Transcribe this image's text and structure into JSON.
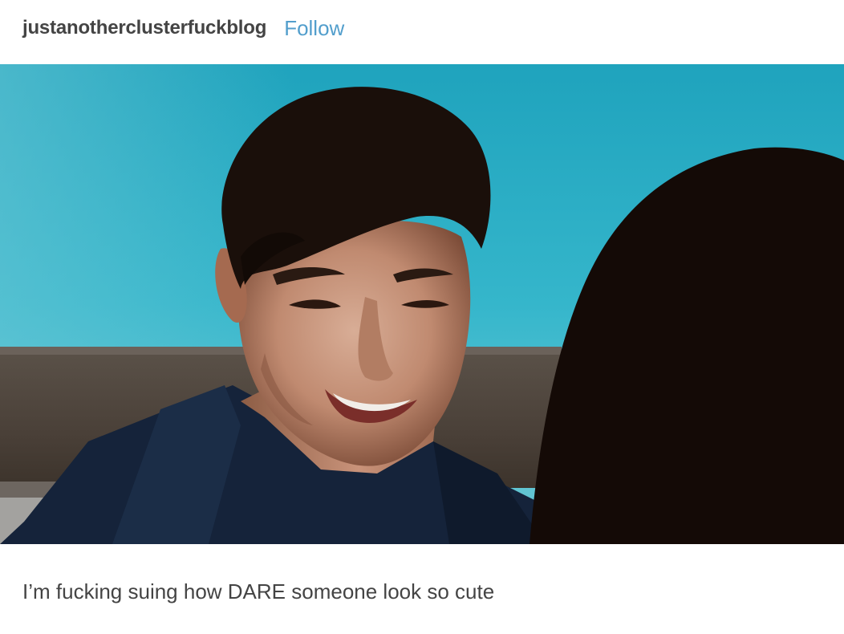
{
  "post": {
    "blog_name": "justanotherclusterfuckblog",
    "follow_label": "Follow",
    "caption": "I’m fucking suing how DARE someone look so cute",
    "media": {
      "type": "animated-gif",
      "subject": "smiling young man with dark hair in a navy hoodie, blue sky background"
    }
  },
  "colors": {
    "link": "#529ecc",
    "text": "#444444",
    "sky": "#2ab0c8"
  }
}
